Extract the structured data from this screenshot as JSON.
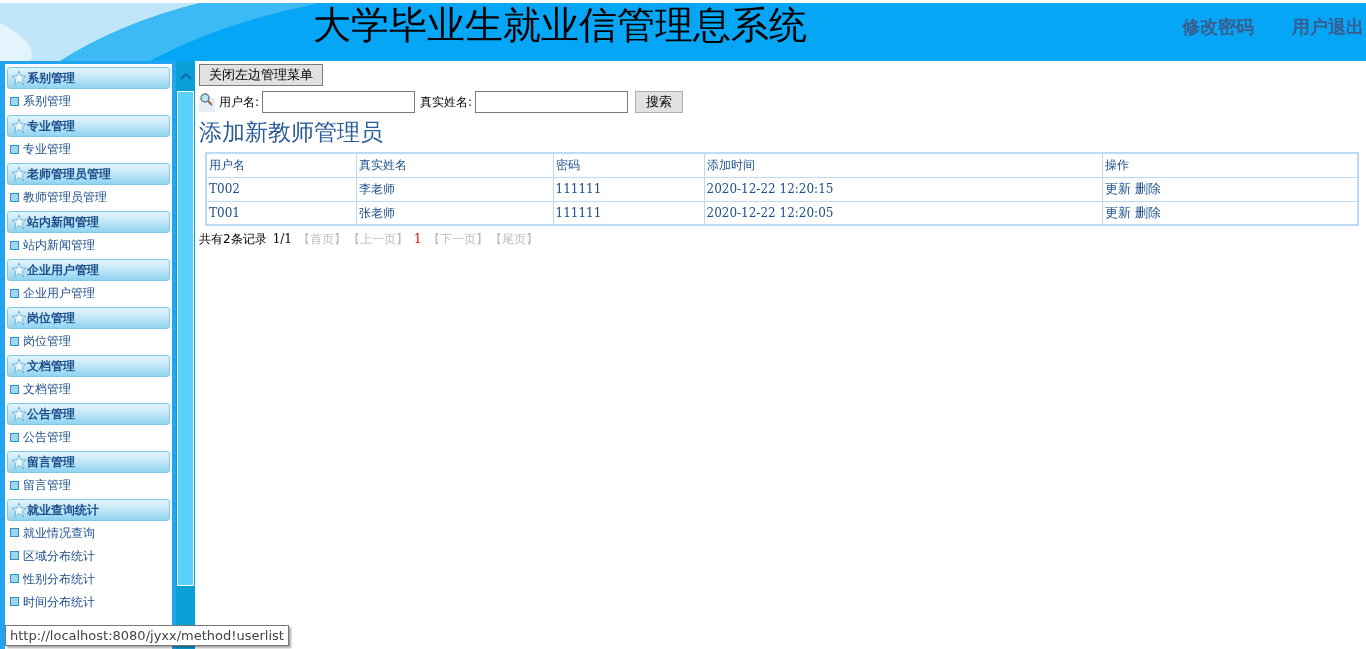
{
  "header": {
    "title": "大学毕业生就业信管理息系统",
    "links": [
      "修改密码",
      "用户退出"
    ]
  },
  "sidebar": {
    "groups": [
      {
        "title": "系别管理",
        "items": [
          "系别管理"
        ]
      },
      {
        "title": "专业管理",
        "items": [
          "专业管理"
        ]
      },
      {
        "title": "老师管理员管理",
        "items": [
          "教师管理员管理"
        ]
      },
      {
        "title": "站内新闻管理",
        "items": [
          "站内新闻管理"
        ]
      },
      {
        "title": "企业用户管理",
        "items": [
          "企业用户管理"
        ]
      },
      {
        "title": "岗位管理",
        "items": [
          "岗位管理"
        ]
      },
      {
        "title": "文档管理",
        "items": [
          "文档管理"
        ]
      },
      {
        "title": "公告管理",
        "items": [
          "公告管理"
        ]
      },
      {
        "title": "留言管理",
        "items": [
          "留言管理"
        ]
      },
      {
        "title": "就业查询统计",
        "items": [
          "就业情况查询",
          "区域分布统计",
          "性别分布统计",
          "时间分布统计"
        ]
      }
    ]
  },
  "toggle_button": "关闭左边管理菜单",
  "search": {
    "fields": [
      {
        "label": "用户名:"
      },
      {
        "label": "真实姓名:"
      }
    ],
    "button": "搜索"
  },
  "add_link": "添加新教师管理员",
  "table": {
    "columns": [
      "用户名",
      "真实姓名",
      "密码",
      "添加时间",
      "操作"
    ],
    "rows": [
      {
        "cells": [
          "T002",
          "李老师",
          "111111",
          "2020-12-22 12:20:15"
        ],
        "actions": [
          "更新",
          "删除"
        ]
      },
      {
        "cells": [
          "T001",
          "张老师",
          "111111",
          "2020-12-22 12:20:05"
        ],
        "actions": [
          "更新",
          "删除"
        ]
      }
    ]
  },
  "pager": {
    "summary": "共有2条记录",
    "pages": "1/1",
    "first": "【首页】",
    "prev": "【上一页】",
    "current": "1",
    "next": "【下一页】",
    "last": "【尾页】"
  },
  "status_tooltip": "http://localhost:8080/jyxx/method!userlist"
}
